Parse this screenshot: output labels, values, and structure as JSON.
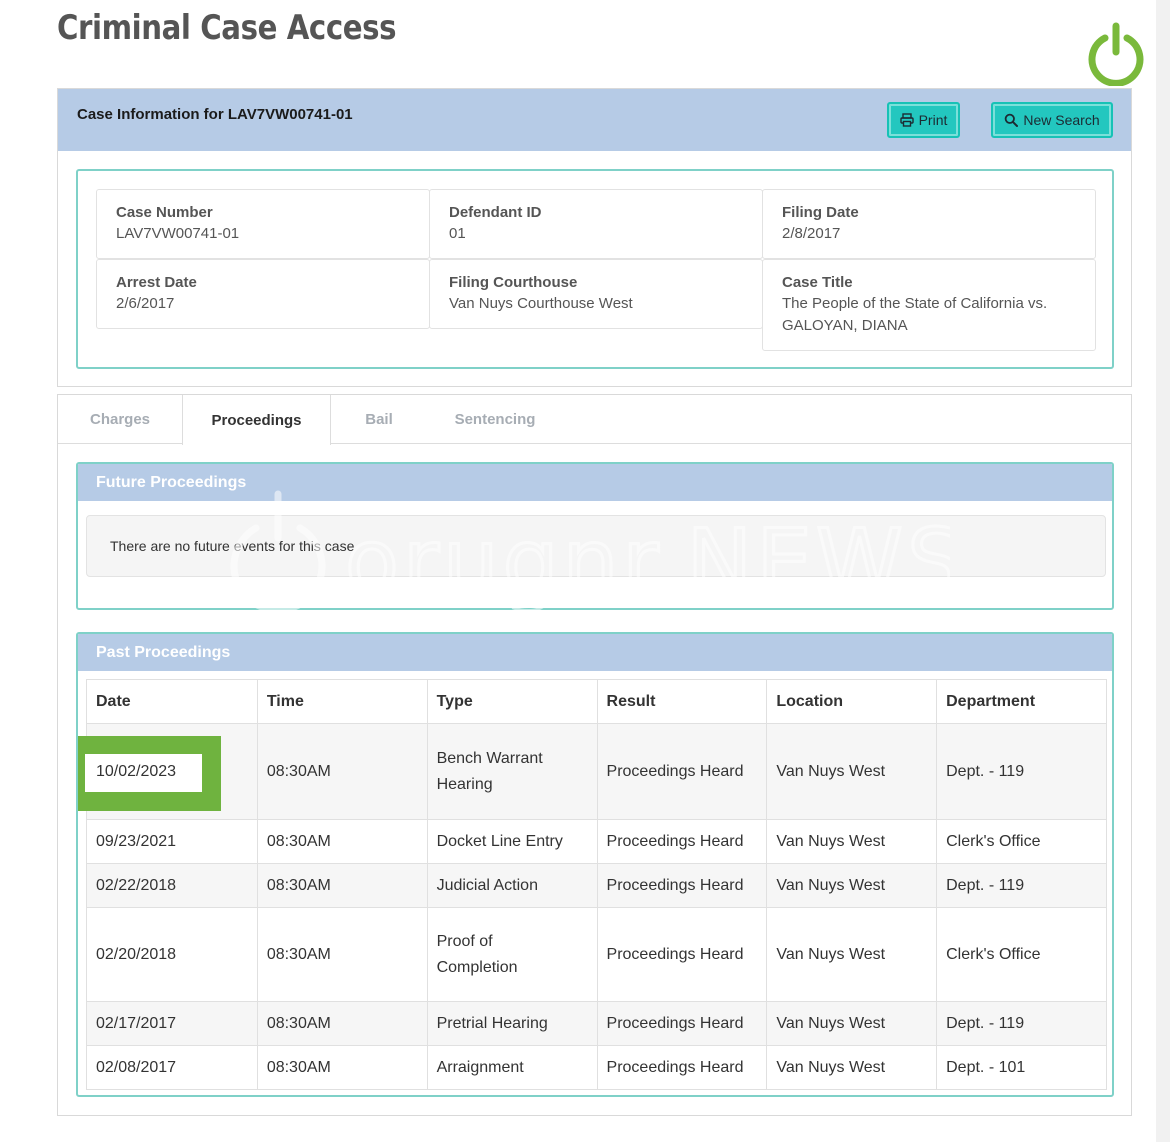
{
  "page_title": "Criminal Case Access",
  "info_panel": {
    "heading": "Case Information for LAV7VW00741-01",
    "print_label": "Print",
    "new_search_label": "New Search",
    "fields": [
      {
        "label": "Case Number",
        "value": "LAV7VW00741-01"
      },
      {
        "label": "Defendant ID",
        "value": "01"
      },
      {
        "label": "Filing Date",
        "value": "2/8/2017"
      },
      {
        "label": "Arrest Date",
        "value": "2/6/2017"
      },
      {
        "label": "Filing Courthouse",
        "value": "Van Nuys Courthouse West"
      },
      {
        "label": "Case Title",
        "value": "The People of the State of California vs. GALOYAN, DIANA"
      }
    ]
  },
  "tabs": [
    "Charges",
    "Proceedings",
    "Bail",
    "Sentencing"
  ],
  "active_tab": "Proceedings",
  "future": {
    "heading": "Future Proceedings",
    "empty_message": "There are no future events for this case"
  },
  "past": {
    "heading": "Past Proceedings",
    "columns": [
      "Date",
      "Time",
      "Type",
      "Result",
      "Location",
      "Department"
    ],
    "rows": [
      [
        "10/02/2023",
        "08:30AM",
        "Bench Warrant Hearing",
        "Proceedings Heard",
        "Van Nuys West",
        "Dept. - 119"
      ],
      [
        "09/23/2021",
        "08:30AM",
        "Docket Line Entry",
        "Proceedings Heard",
        "Van Nuys West",
        "Clerk's Office"
      ],
      [
        "02/22/2018",
        "08:30AM",
        "Judicial Action",
        "Proceedings Heard",
        "Van Nuys West",
        "Dept. - 119"
      ],
      [
        "02/20/2018",
        "08:30AM",
        "Proof of Completion",
        "Proceedings Heard",
        "Van Nuys West",
        "Clerk's Office"
      ],
      [
        "02/17/2017",
        "08:30AM",
        "Pretrial Hearing",
        "Proceedings Heard",
        "Van Nuys West",
        "Dept. - 119"
      ],
      [
        "02/08/2017",
        "08:30AM",
        "Arraignment",
        "Proceedings Heard",
        "Van Nuys West",
        "Dept. - 101"
      ]
    ]
  },
  "watermark": "orugnr.NEWS",
  "colors": {
    "panel_header": "#b6cbe6",
    "button_teal": "#23c7bf",
    "box_border": "#7fd1c8",
    "highlight_green": "#6fb33f",
    "power_icon": "#7ab93b"
  }
}
